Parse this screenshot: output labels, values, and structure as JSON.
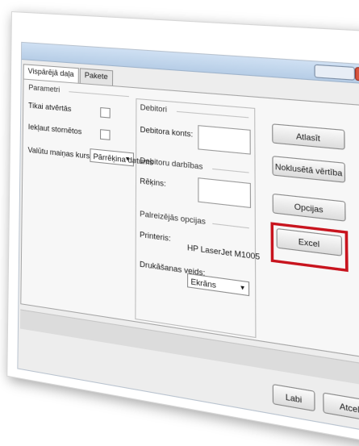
{
  "tabs": [
    "Vispārējā daļa",
    "Pakete"
  ],
  "left_group": {
    "title": "Parametri",
    "option1_label": "Tikai atvērtās",
    "option2_label": "Iekļaut stornētos",
    "rate_label": "Valūtu maiņas kursi:",
    "rate_value": "Pārrēķina datums"
  },
  "debtors_group": {
    "title": "Debitori",
    "account_label": "Debitora konts:"
  },
  "debtor_ops_group": {
    "title": "Debitoru darbības",
    "invoice_label": "Rēķins:"
  },
  "output_group": {
    "title": "Palreizējās opcijas",
    "printer_label": "Printeris:",
    "printer_value": "HP LaserJet M1005",
    "print_mode_label": "Drukāšanas veids:",
    "print_mode_value": "Ekrāns"
  },
  "buttons": {
    "select": "Atlasīt",
    "default": "Noklusētā vērtība",
    "options": "Opcijas",
    "excel": "Excel",
    "ok": "Labi",
    "cancel": "Atcelt"
  },
  "colors": {
    "highlight": "#c8141e"
  }
}
